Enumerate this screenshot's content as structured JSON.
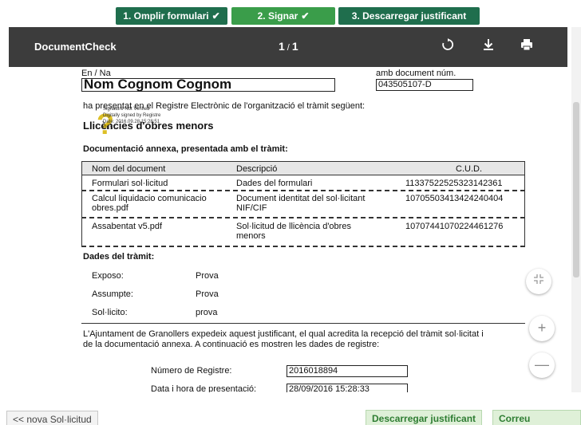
{
  "steps": [
    {
      "label": "1. Omplir formulari",
      "check": "✔"
    },
    {
      "label": "2. Signar",
      "check": "✔"
    },
    {
      "label": "3. Descarregar justificant"
    }
  ],
  "viewer": {
    "title": "DocumentCheck",
    "page_current": "1",
    "page_sep": "/",
    "page_total": "1"
  },
  "doc": {
    "en_na_label": "En / Na",
    "name_value": "Nom Cognom Cognom",
    "amb_doc_label": "amb document núm.",
    "doc_number": "043505107-D",
    "presented_text": "ha presentat en el Registre Electrònic de l'organització el tràmit següent:",
    "procedure_title": "Llicències d'obres menors",
    "signature": {
      "line1": "Signature Not Verified",
      "line2": "Digitally signed by Registre",
      "line3": "Date: 2016.09.28 15:28:51",
      "line4": "CEST"
    },
    "annex_title": "Documentació annexa, presentada amb el tràmit:",
    "table": {
      "headers": [
        "Nom del document",
        "Descripció",
        "C.U.D."
      ],
      "rows": [
        {
          "name": "Formulari sol·licitud",
          "desc": "Dades del formulari",
          "cud": "11337522525323142361"
        },
        {
          "name": "Calcul liquidacio comunicacio obres.pdf",
          "desc": "Document identitat del sol·licitant NIF/CIF",
          "cud": "10705503413424240404"
        },
        {
          "name": "Assabentat v5.pdf",
          "desc": "Sol·licitud de llicència d'obres menors",
          "cud": "10707441070224461276"
        }
      ]
    },
    "dades_title": "Dades del tràmit:",
    "fields": [
      {
        "label": "Exposo:",
        "value": "Prova"
      },
      {
        "label": "Assumpte:",
        "value": "Prova"
      },
      {
        "label": "Sol·licito:",
        "value": "prova"
      }
    ],
    "ajuntament_text_1": "L'Ajuntament de Granollers expedeix aquest justificant, el qual acredita la recepció del tràmit sol·licitat i",
    "ajuntament_text_2": "de la  documentació annexa. A continuació es mostren les dades de registre:",
    "registre_label": "Número de Registre:",
    "registre_value": "2016018894",
    "data_label": "Data i hora de presentació:",
    "data_value": "28/09/2016 15:28:33"
  },
  "buttons": {
    "back": "<< nova Sol·licitud",
    "download": "Descarregar justificant",
    "mail": "Correu electrònic"
  },
  "icons": {
    "rotate": "rotate-icon",
    "download": "download-icon",
    "print": "print-icon",
    "compress": "compress-icon",
    "zoom_in": "plus-icon",
    "zoom_out": "minus-icon"
  },
  "colors": {
    "step_dark": "#1f6e4d",
    "step_active": "#3a9d4a",
    "toolbar": "#3c3c3c",
    "button_green_bg": "#dff0d8",
    "button_green_text": "#2e7d32"
  }
}
